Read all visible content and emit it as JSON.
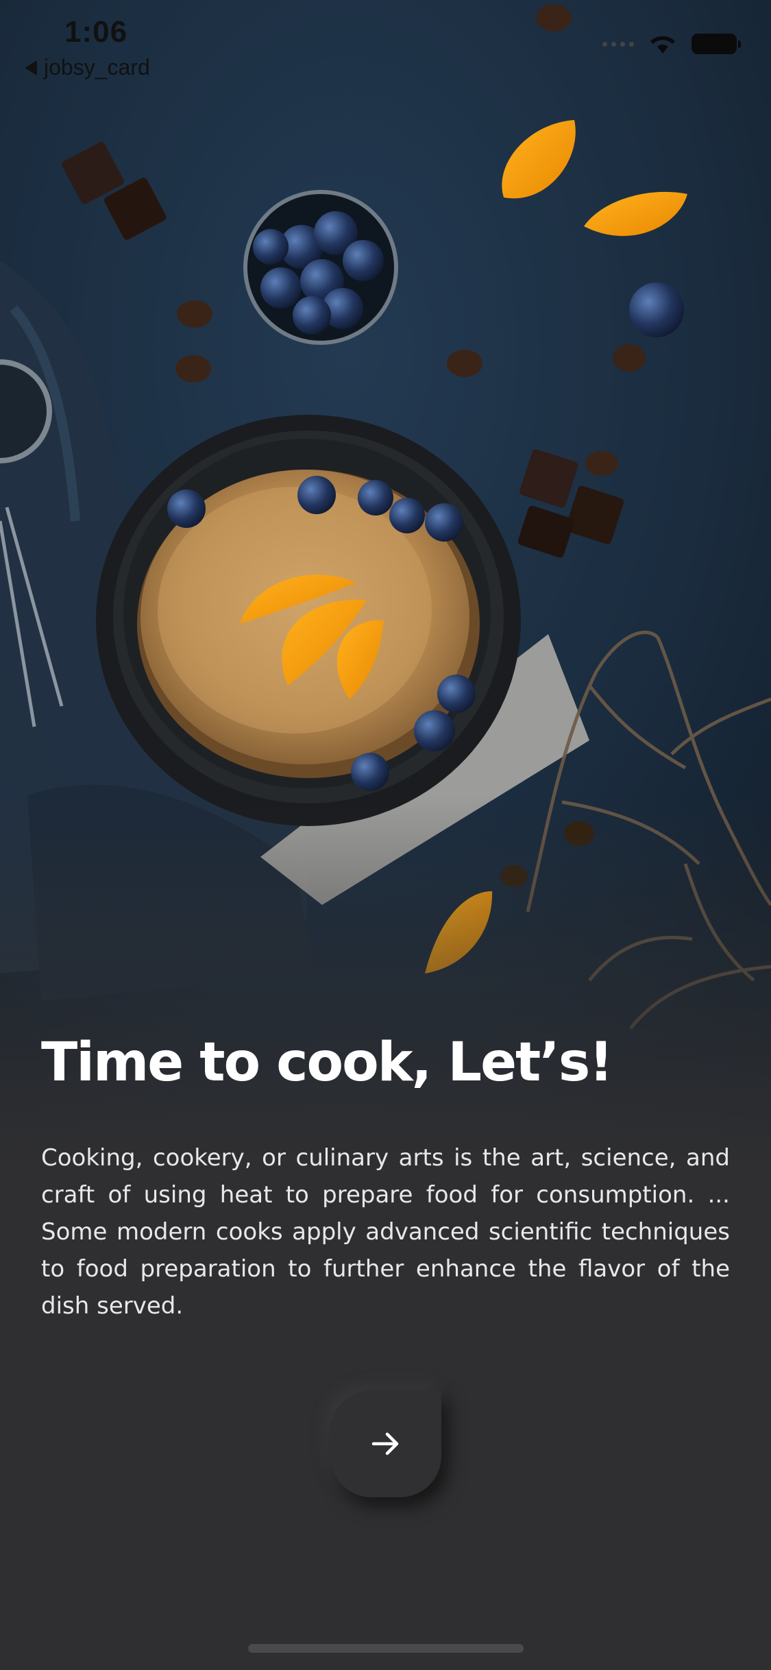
{
  "status_bar": {
    "time": "1:06",
    "back_label": "jobsy_card"
  },
  "onboarding": {
    "title": "Time to cook, Let’s!",
    "description": "Cooking, cookery, or culinary arts is the art, science, and craft of using heat to prepare food for consumption. ... Some modern cooks apply advanced scientific techniques to food preparation to further enhance the flavor of the dish served.",
    "next_icon": "arrow-right-icon"
  },
  "colors": {
    "background": "#2f2f31",
    "hero_base": "#1a2a3b",
    "text_primary": "#ffffff",
    "button_bg": "#303033"
  }
}
